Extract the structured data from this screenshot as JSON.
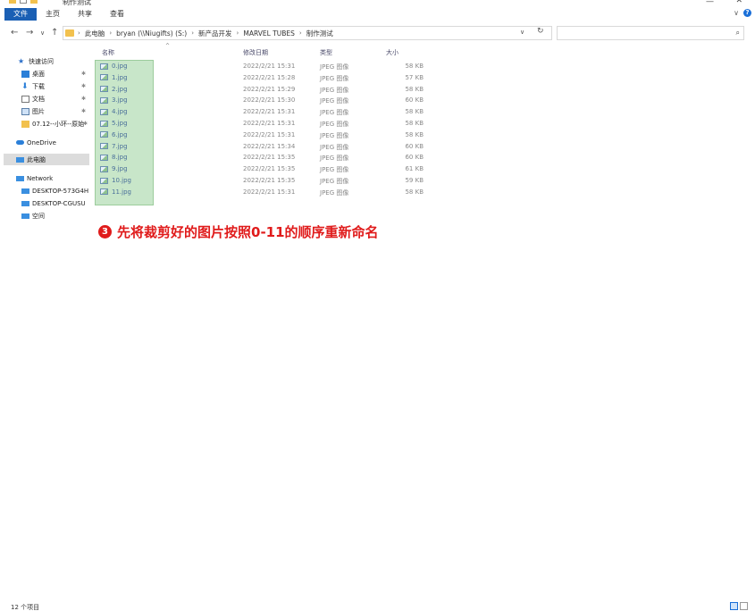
{
  "window": {
    "title": "制作测试",
    "min_glyph": "—",
    "close_glyph": "✕"
  },
  "ribbon": {
    "tabs": [
      {
        "label": "文件",
        "active": true
      },
      {
        "label": "主页",
        "active": false
      },
      {
        "label": "共享",
        "active": false
      },
      {
        "label": "查看",
        "active": false
      }
    ],
    "expand_glyph": "∨",
    "help_glyph": "?"
  },
  "nav_buttons": {
    "back": "←",
    "forward": "→",
    "recent": "∨",
    "up": "↑"
  },
  "address": {
    "crumbs": [
      "此电脑",
      "bryan (\\\\Niugifts) (S:)",
      "新产品开发",
      "MARVEL TUBES",
      "制作测试"
    ],
    "separator": "›",
    "dropdown_glyph": "∨",
    "refresh_glyph": "↻"
  },
  "search": {
    "placeholder": "",
    "icon_glyph": "⌕"
  },
  "nav_pane": {
    "items": [
      {
        "label": "快速访问",
        "icon": "star-icon",
        "pinned": false,
        "selected": false
      },
      {
        "label": "桌面",
        "icon": "desktop-icon",
        "pinned": true,
        "selected": false
      },
      {
        "label": "下载",
        "icon": "download-icon",
        "pinned": true,
        "selected": false
      },
      {
        "label": "文档",
        "icon": "document-icon",
        "pinned": true,
        "selected": false
      },
      {
        "label": "图片",
        "icon": "picture-icon",
        "pinned": true,
        "selected": false
      },
      {
        "label": "07.12--小环--原始",
        "icon": "folder-icon",
        "pinned": true,
        "selected": false
      },
      {
        "label": "OneDrive",
        "icon": "cloud-icon",
        "pinned": false,
        "selected": false
      },
      {
        "label": "此电脑",
        "icon": "computer-icon",
        "pinned": false,
        "selected": true
      },
      {
        "label": "Network",
        "icon": "network-icon",
        "pinned": false,
        "selected": false
      },
      {
        "label": "DESKTOP-573G4H",
        "icon": "computer-icon",
        "pinned": false,
        "selected": false
      },
      {
        "label": "DESKTOP-CGUSU",
        "icon": "computer-icon",
        "pinned": false,
        "selected": false
      },
      {
        "label": "空间",
        "icon": "computer-icon",
        "pinned": false,
        "selected": false
      }
    ],
    "pin_glyph": "✱"
  },
  "columns": {
    "name": "名称",
    "date": "修改日期",
    "type": "类型",
    "size": "大小",
    "sort_glyph": "^"
  },
  "files": [
    {
      "name": "0.jpg",
      "date": "2022/2/21 15:31",
      "type": "JPEG 图像",
      "size": "58 KB"
    },
    {
      "name": "1.jpg",
      "date": "2022/2/21 15:28",
      "type": "JPEG 图像",
      "size": "57 KB"
    },
    {
      "name": "2.jpg",
      "date": "2022/2/21 15:29",
      "type": "JPEG 图像",
      "size": "58 KB"
    },
    {
      "name": "3.jpg",
      "date": "2022/2/21 15:30",
      "type": "JPEG 图像",
      "size": "60 KB"
    },
    {
      "name": "4.jpg",
      "date": "2022/2/21 15:31",
      "type": "JPEG 图像",
      "size": "58 KB"
    },
    {
      "name": "5.jpg",
      "date": "2022/2/21 15:31",
      "type": "JPEG 图像",
      "size": "58 KB"
    },
    {
      "name": "6.jpg",
      "date": "2022/2/21 15:31",
      "type": "JPEG 图像",
      "size": "58 KB"
    },
    {
      "name": "7.jpg",
      "date": "2022/2/21 15:34",
      "type": "JPEG 图像",
      "size": "60 KB"
    },
    {
      "name": "8.jpg",
      "date": "2022/2/21 15:35",
      "type": "JPEG 图像",
      "size": "60 KB"
    },
    {
      "name": "9.jpg",
      "date": "2022/2/21 15:35",
      "type": "JPEG 图像",
      "size": "61 KB"
    },
    {
      "name": "10.jpg",
      "date": "2022/2/21 15:35",
      "type": "JPEG 图像",
      "size": "59 KB"
    },
    {
      "name": "11.jpg",
      "date": "2022/2/21 15:31",
      "type": "JPEG 图像",
      "size": "58 KB"
    }
  ],
  "annotation": {
    "badge": "3",
    "text": "先将裁剪好的图片按照0-11的顺序重新命名",
    "color": "#e01b1b"
  },
  "status": {
    "item_count": "12 个项目"
  },
  "colors": {
    "accent": "#1a5fb4",
    "selection_fill": "#c8e6c9",
    "folder": "#f2c14e"
  }
}
